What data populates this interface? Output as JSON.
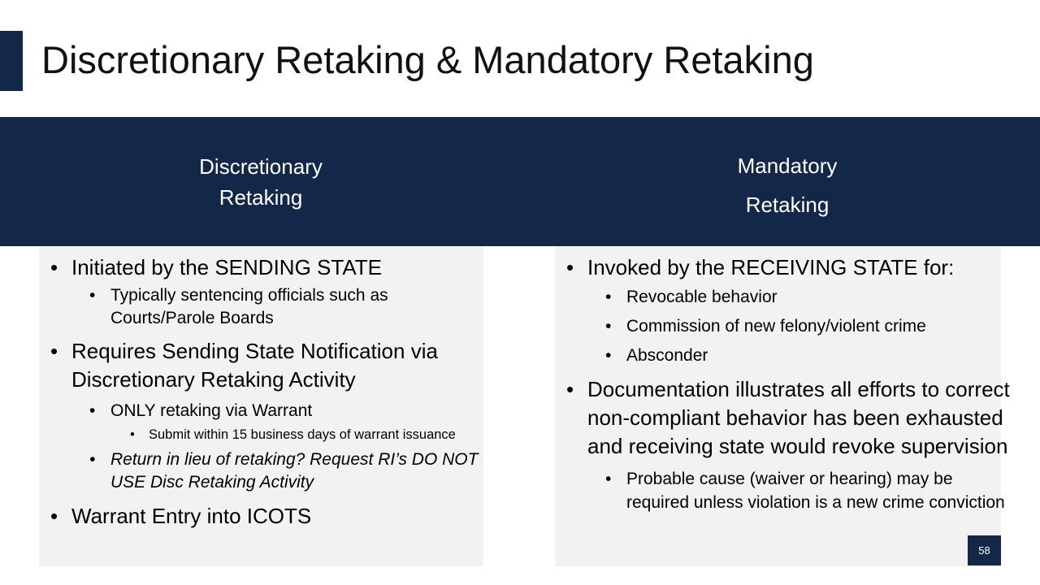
{
  "slide": {
    "title": "Discretionary Retaking & Mandatory Retaking",
    "page_number": "58"
  },
  "left_column": {
    "heading_line1": "Discretionary",
    "heading_line2": "Retaking",
    "items": [
      "Initiated by the SENDING STATE",
      "Typically sentencing officials such as Courts/Parole Boards",
      "Requires Sending State Notification via Discretionary Retaking Activity",
      "ONLY retaking via Warrant",
      "Submit within 15 business days of warrant issuance",
      "Return in lieu of retaking? Request RI’s DO NOT USE Disc Retaking Activity",
      "Warrant Entry into ICOTS"
    ]
  },
  "right_column": {
    "heading_line1": "Mandatory",
    "heading_line2": "Retaking",
    "items": [
      "Invoked by the RECEIVING STATE for:",
      "Revocable behavior",
      "Commission of new felony/violent crime",
      "Absconder",
      "Documentation illustrates all efforts to correct non-compliant behavior has been exhausted and receiving state would revoke supervision",
      "Probable cause (waiver or hearing) may be required unless violation is a new crime conviction"
    ]
  },
  "colors": {
    "navy": "#132848",
    "panel_gray": "#f2f2f2"
  }
}
